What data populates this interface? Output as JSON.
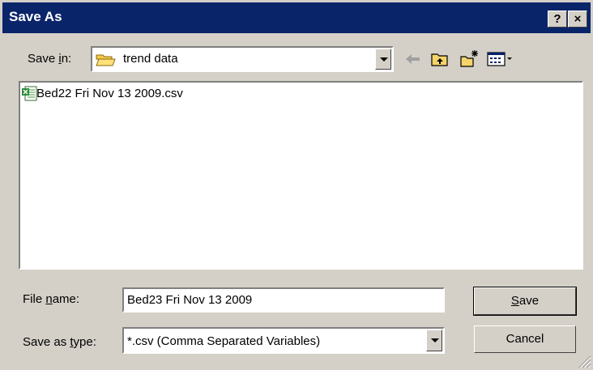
{
  "window": {
    "title": "Save As",
    "help_label": "?",
    "close_label": "×"
  },
  "save_in": {
    "label_pre": "Save ",
    "label_mnemonic": "i",
    "label_post": "n:",
    "value": "trend data",
    "folder_icon": "folder-icon"
  },
  "toolbar": {
    "icons": [
      "back-arrow-icon",
      "up-folder-icon",
      "new-folder-icon",
      "view-menu-icon"
    ]
  },
  "file_list": [
    {
      "name": "Bed22  Fri Nov 13 2009.csv",
      "icon": "excel-csv-icon"
    }
  ],
  "file_name": {
    "label_pre": "File ",
    "label_mnemonic": "n",
    "label_post": "ame:",
    "value": "Bed23  Fri Nov 13 2009"
  },
  "save_type": {
    "label_pre": "Save as ",
    "label_mnemonic": "t",
    "label_post": "ype:",
    "value": "*.csv (Comma Separated Variables)"
  },
  "buttons": {
    "save_mnemonic": "S",
    "save_rest": "ave",
    "cancel": "Cancel"
  }
}
